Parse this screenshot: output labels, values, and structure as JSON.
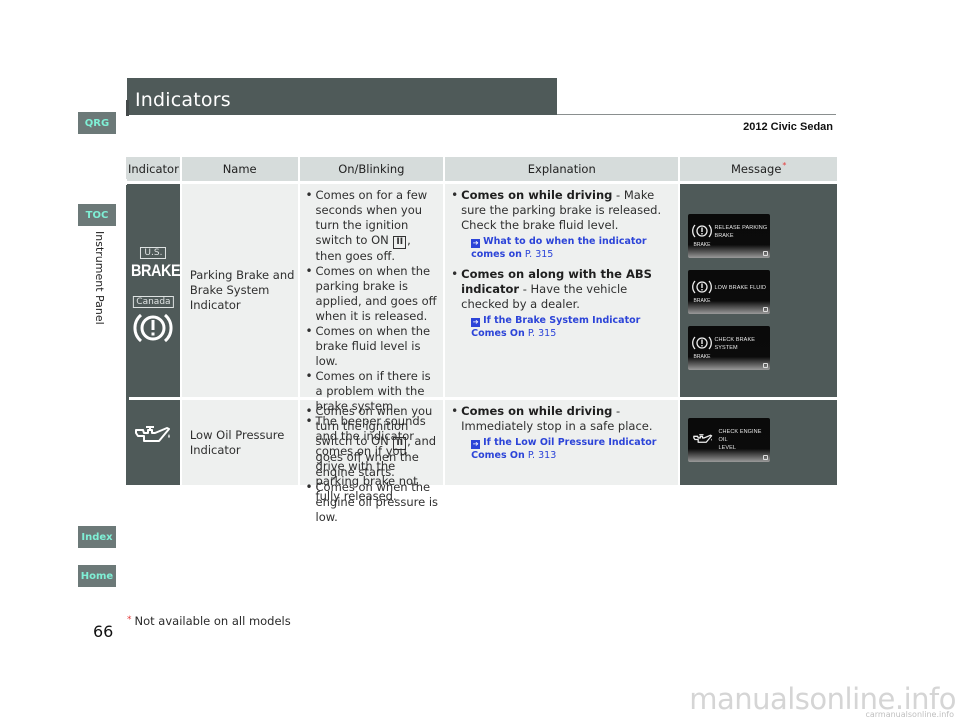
{
  "page": {
    "title": "Indicators",
    "model": "2012 Civic Sedan",
    "section_label": "Instrument Panel",
    "page_number": "66",
    "footnote_marker": "*",
    "footnote_text": "Not available on all models",
    "watermark": "manualsonline.info",
    "watermark_small": "carmanualsonline.info"
  },
  "nav": {
    "qrg": "QRG",
    "toc": "TOC",
    "index": "Index",
    "home": "Home"
  },
  "colors": {
    "title_bar": "#4f5a59",
    "nav_tab_bg": "#6c7978",
    "nav_tab_text": "#7ff0d6",
    "header_bg": "#d6dcdb",
    "cell_bg": "#eef0ef",
    "link": "#2c44d8",
    "asterisk": "#e43b3b"
  },
  "table": {
    "headers": [
      "Indicator",
      "Name",
      "On/Blinking",
      "Explanation",
      "Message"
    ],
    "header_asterisk": "*",
    "rows": [
      {
        "indicator": {
          "us_label": "U.S.",
          "us_text": "BRAKE",
          "canada_label": "Canada",
          "icon": "brake-warning-icon"
        },
        "name": "Parking Brake and Brake System Indicator",
        "on_blinking": [
          {
            "before": "Comes on for a few seconds when you turn the ignition switch to ON ",
            "switch": "II",
            "after": ", then goes off."
          },
          {
            "text": "Comes on when the parking brake is applied, and goes off when it is released."
          },
          {
            "text": "Comes on when the brake fluid level is low."
          },
          {
            "text": "Comes on if there is a problem with the brake system."
          },
          {
            "text": "The beeper sounds and the indicator comes on if you drive with the parking brake not fully released."
          }
        ],
        "explanation": [
          {
            "bold": "Comes on while driving",
            "text": " - Make sure the parking brake is released. Check the brake fluid level.",
            "ref_link": "What to do when the indicator comes on",
            "ref_page": "P. 315"
          },
          {
            "bold": "Comes on along with the ABS indicator",
            "text": " - Have the vehicle checked by a dealer.",
            "ref_link": "If the Brake System Indicator Comes On",
            "ref_page": "P. 315"
          }
        ],
        "messages": [
          {
            "line1": "RELEASE PARKING",
            "line2": "BRAKE",
            "icon_label": "BRAKE"
          },
          {
            "line1": "LOW BRAKE FLUID",
            "line2": "",
            "icon_label": "BRAKE"
          },
          {
            "line1": "CHECK BRAKE",
            "line2": "SYSTEM",
            "icon_label": "BRAKE"
          }
        ]
      },
      {
        "indicator": {
          "icon": "oil-can-icon"
        },
        "name": "Low Oil Pressure Indicator",
        "on_blinking": [
          {
            "before": "Comes on when you turn the ignition switch to ON ",
            "switch": "II",
            "after": ", and goes off when the engine starts."
          },
          {
            "text": "Comes on when the engine oil pressure is low."
          }
        ],
        "explanation": [
          {
            "bold": "Comes on while driving",
            "text": " - Immediately stop in a safe place.",
            "ref_link": "If the Low Oil Pressure Indicator Comes On",
            "ref_page": "P. 313"
          }
        ],
        "messages": [
          {
            "line1": "CHECK ENGINE OIL",
            "line2": "LEVEL"
          }
        ]
      }
    ]
  }
}
